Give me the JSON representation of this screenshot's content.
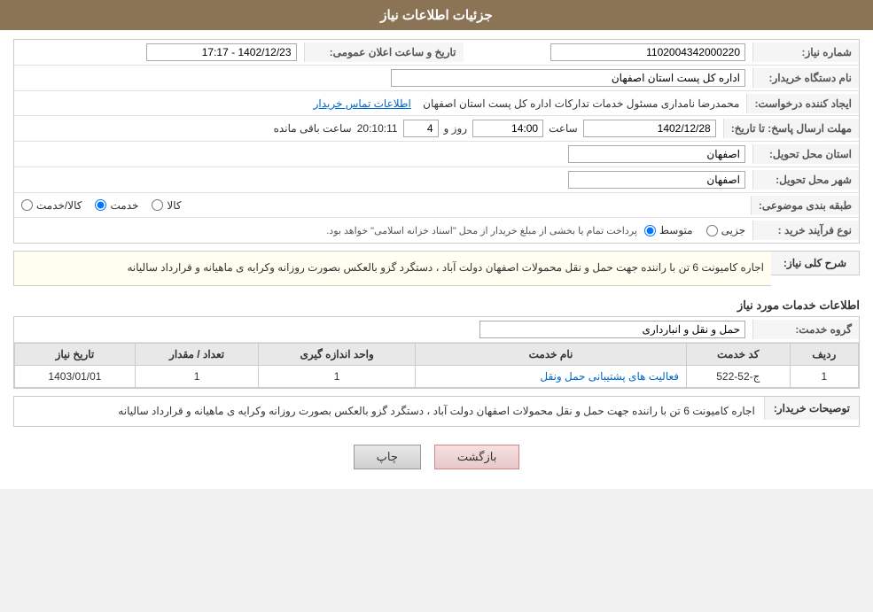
{
  "header": {
    "title": "جزئیات اطلاعات نیاز"
  },
  "fields": {
    "shomara_niaz_label": "شماره نیاز:",
    "shomara_niaz_value": "1102004342000220",
    "nam_dastgah_label": "نام دستگاه خریدار:",
    "nam_dastgah_value": "اداره کل پست استان اصفهان",
    "ijad_konande_label": "ایجاد کننده درخواست:",
    "ijad_konande_value": "محمدرضا نامداری مسئول خدمات تدارکات اداره کل پست استان اصفهان",
    "ijad_konande_link": "اطلاعات تماس خریدار",
    "mohlat_label": "مهلت ارسال پاسخ: تا تاریخ:",
    "mohlat_date": "1402/12/28",
    "mohlat_saat_label": "ساعت",
    "mohlat_saat": "14:00",
    "mohlat_rooz_label": "روز و",
    "mohlat_rooz": "4",
    "mohlat_saat_mande_label": "ساعت باقی مانده",
    "mohlat_saat_mande": "20:10:11",
    "tarikh_label": "تاریخ و ساعت اعلان عمومی:",
    "tarikh_value": "1402/12/23 - 17:17",
    "ostan_tahvil_label": "استان محل تحویل:",
    "ostan_tahvil_value": "اصفهان",
    "shahr_tahvil_label": "شهر محل تحویل:",
    "shahr_tahvil_value": "اصفهان",
    "tabaqe_label": "طبقه بندی موضوعی:",
    "tabaqe_options": [
      "کالا",
      "خدمت",
      "کالا/خدمت"
    ],
    "tabaqe_selected": "خدمت",
    "nooe_farayand_label": "نوع فرآیند خرید :",
    "nooe_options": [
      "جزیی",
      "متوسط"
    ],
    "nooe_note": "پرداخت تمام یا بخشی از مبلغ خریدار از محل \"اسناد خزانه اسلامی\" خواهد بود.",
    "sharh_label": "شرح کلی نیاز:",
    "sharh_value": "اجاره کامیونت 6 تن با راننده  جهت حمل و نقل محمولات اصفهان دولت آباد ، دستگرد گزو بالعکس بصورت روزانه وکرایه ی ماهیانه و قرارداد سالیانه",
    "khadamat_title": "اطلاعات خدمات مورد نیاز",
    "grooh_label": "گروه خدمت:",
    "grooh_value": "حمل و نقل و انبارداری",
    "table_headers": {
      "radif": "ردیف",
      "code": "کد خدمت",
      "name": "نام خدمت",
      "unit": "واحد اندازه گیری",
      "count": "تعداد / مقدار",
      "date": "تاریخ نیاز"
    },
    "table_rows": [
      {
        "radif": "1",
        "code": "ج-52-522",
        "name": "فعالیت های پشتیبانی حمل ونقل",
        "unit": "1",
        "count": "1",
        "date": "1403/01/01"
      }
    ],
    "tosif_label": "توصیحات خریدار:",
    "tosif_value": "اجاره کامیونت 6 تن با راننده  جهت حمل و نقل محمولات اصفهان دولت آباد ، دستگرد گزو بالعکس بصورت روزانه وکرایه ی ماهیانه و قرارداد سالیانه",
    "btn_back": "بازگشت",
    "btn_print": "چاپ"
  }
}
